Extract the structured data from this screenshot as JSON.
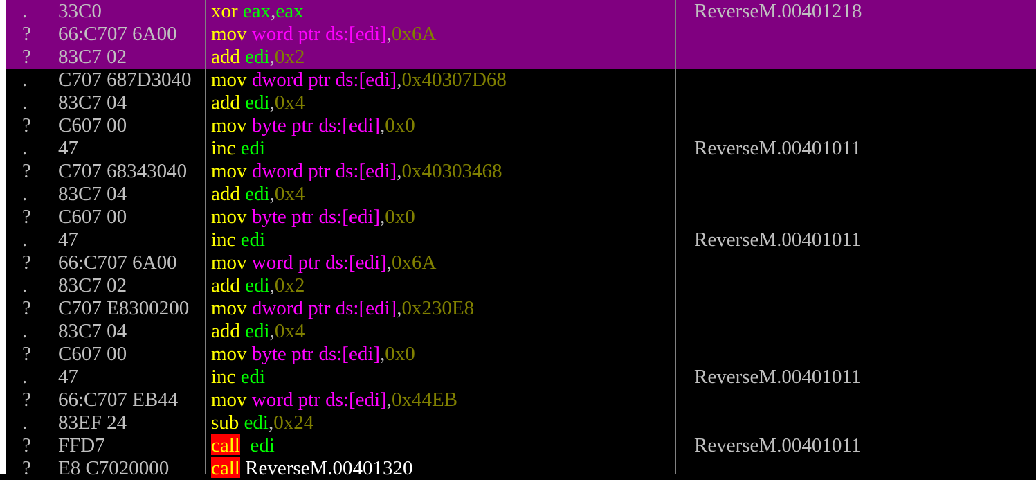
{
  "colors": {
    "selection": "#800080",
    "mnemonic": "#ffff00",
    "register": "#00ff00",
    "memory_operand": "#ff00ff",
    "immediate": "#808000",
    "call_highlight": "#ff0000",
    "text": "#c0c0c0",
    "background": "#000000"
  },
  "rows": [
    {
      "mark": ".",
      "bytes": "33C0",
      "selected": true,
      "instr": [
        {
          "t": "op",
          "v": "xor"
        },
        {
          "t": "sp",
          "v": " "
        },
        {
          "t": "reg",
          "v": "eax"
        },
        {
          "t": "punc",
          "v": ","
        },
        {
          "t": "reg",
          "v": "eax"
        }
      ],
      "comment": "ReverseM.00401218"
    },
    {
      "mark": "?",
      "bytes": "66:C707 6A00",
      "selected": true,
      "instr": [
        {
          "t": "op",
          "v": "mov"
        },
        {
          "t": "sp",
          "v": " "
        },
        {
          "t": "mem",
          "v": "word ptr ds:[edi]"
        },
        {
          "t": "punc",
          "v": ","
        },
        {
          "t": "imm",
          "v": "0x6A"
        }
      ],
      "comment": ""
    },
    {
      "mark": "?",
      "bytes": "83C7 02",
      "selected": true,
      "instr": [
        {
          "t": "op",
          "v": "add"
        },
        {
          "t": "sp",
          "v": " "
        },
        {
          "t": "reg",
          "v": "edi"
        },
        {
          "t": "punc",
          "v": ","
        },
        {
          "t": "imm",
          "v": "0x2"
        }
      ],
      "comment": ""
    },
    {
      "mark": ".",
      "bytes": "C707 687D3040",
      "selected": false,
      "instr": [
        {
          "t": "op",
          "v": "mov"
        },
        {
          "t": "sp",
          "v": " "
        },
        {
          "t": "mem",
          "v": "dword ptr ds:[edi]"
        },
        {
          "t": "punc",
          "v": ","
        },
        {
          "t": "imm",
          "v": "0x40307D68"
        }
      ],
      "comment": ""
    },
    {
      "mark": ".",
      "bytes": "83C7 04",
      "selected": false,
      "instr": [
        {
          "t": "op",
          "v": "add"
        },
        {
          "t": "sp",
          "v": " "
        },
        {
          "t": "reg",
          "v": "edi"
        },
        {
          "t": "punc",
          "v": ","
        },
        {
          "t": "imm",
          "v": "0x4"
        }
      ],
      "comment": ""
    },
    {
      "mark": "?",
      "bytes": "C607 00",
      "selected": false,
      "instr": [
        {
          "t": "op",
          "v": "mov"
        },
        {
          "t": "sp",
          "v": " "
        },
        {
          "t": "mem",
          "v": "byte ptr ds:[edi]"
        },
        {
          "t": "punc",
          "v": ","
        },
        {
          "t": "imm",
          "v": "0x0"
        }
      ],
      "comment": ""
    },
    {
      "mark": ".",
      "bytes": "47",
      "selected": false,
      "instr": [
        {
          "t": "op",
          "v": "inc"
        },
        {
          "t": "sp",
          "v": " "
        },
        {
          "t": "reg",
          "v": "edi"
        }
      ],
      "comment": "ReverseM.00401011"
    },
    {
      "mark": "?",
      "bytes": "C707 68343040",
      "selected": false,
      "instr": [
        {
          "t": "op",
          "v": "mov"
        },
        {
          "t": "sp",
          "v": " "
        },
        {
          "t": "mem",
          "v": "dword ptr ds:[edi]"
        },
        {
          "t": "punc",
          "v": ","
        },
        {
          "t": "imm",
          "v": "0x40303468"
        }
      ],
      "comment": ""
    },
    {
      "mark": ".",
      "bytes": "83C7 04",
      "selected": false,
      "instr": [
        {
          "t": "op",
          "v": "add"
        },
        {
          "t": "sp",
          "v": " "
        },
        {
          "t": "reg",
          "v": "edi"
        },
        {
          "t": "punc",
          "v": ","
        },
        {
          "t": "imm",
          "v": "0x4"
        }
      ],
      "comment": ""
    },
    {
      "mark": "?",
      "bytes": "C607 00",
      "selected": false,
      "instr": [
        {
          "t": "op",
          "v": "mov"
        },
        {
          "t": "sp",
          "v": " "
        },
        {
          "t": "mem",
          "v": "byte ptr ds:[edi]"
        },
        {
          "t": "punc",
          "v": ","
        },
        {
          "t": "imm",
          "v": "0x0"
        }
      ],
      "comment": ""
    },
    {
      "mark": ".",
      "bytes": "47",
      "selected": false,
      "instr": [
        {
          "t": "op",
          "v": "inc"
        },
        {
          "t": "sp",
          "v": " "
        },
        {
          "t": "reg",
          "v": "edi"
        }
      ],
      "comment": "ReverseM.00401011"
    },
    {
      "mark": "?",
      "bytes": "66:C707 6A00",
      "selected": false,
      "instr": [
        {
          "t": "op",
          "v": "mov"
        },
        {
          "t": "sp",
          "v": " "
        },
        {
          "t": "mem",
          "v": "word ptr ds:[edi]"
        },
        {
          "t": "punc",
          "v": ","
        },
        {
          "t": "imm",
          "v": "0x6A"
        }
      ],
      "comment": ""
    },
    {
      "mark": ".",
      "bytes": "83C7 02",
      "selected": false,
      "instr": [
        {
          "t": "op",
          "v": "add"
        },
        {
          "t": "sp",
          "v": " "
        },
        {
          "t": "reg",
          "v": "edi"
        },
        {
          "t": "punc",
          "v": ","
        },
        {
          "t": "imm",
          "v": "0x2"
        }
      ],
      "comment": ""
    },
    {
      "mark": "?",
      "bytes": "C707 E8300200",
      "selected": false,
      "instr": [
        {
          "t": "op",
          "v": "mov"
        },
        {
          "t": "sp",
          "v": " "
        },
        {
          "t": "mem",
          "v": "dword ptr ds:[edi]"
        },
        {
          "t": "punc",
          "v": ","
        },
        {
          "t": "imm",
          "v": "0x230E8"
        }
      ],
      "comment": ""
    },
    {
      "mark": ".",
      "bytes": "83C7 04",
      "selected": false,
      "instr": [
        {
          "t": "op",
          "v": "add"
        },
        {
          "t": "sp",
          "v": " "
        },
        {
          "t": "reg",
          "v": "edi"
        },
        {
          "t": "punc",
          "v": ","
        },
        {
          "t": "imm",
          "v": "0x4"
        }
      ],
      "comment": ""
    },
    {
      "mark": "?",
      "bytes": "C607 00",
      "selected": false,
      "instr": [
        {
          "t": "op",
          "v": "mov"
        },
        {
          "t": "sp",
          "v": " "
        },
        {
          "t": "mem",
          "v": "byte ptr ds:[edi]"
        },
        {
          "t": "punc",
          "v": ","
        },
        {
          "t": "imm",
          "v": "0x0"
        }
      ],
      "comment": ""
    },
    {
      "mark": ".",
      "bytes": "47",
      "selected": false,
      "instr": [
        {
          "t": "op",
          "v": "inc"
        },
        {
          "t": "sp",
          "v": " "
        },
        {
          "t": "reg",
          "v": "edi"
        }
      ],
      "comment": "ReverseM.00401011"
    },
    {
      "mark": "?",
      "bytes": "66:C707 EB44",
      "selected": false,
      "instr": [
        {
          "t": "op",
          "v": "mov"
        },
        {
          "t": "sp",
          "v": " "
        },
        {
          "t": "mem",
          "v": "word ptr ds:[edi]"
        },
        {
          "t": "punc",
          "v": ","
        },
        {
          "t": "imm",
          "v": "0x44EB"
        }
      ],
      "comment": ""
    },
    {
      "mark": ".",
      "bytes": "83EF 24",
      "selected": false,
      "instr": [
        {
          "t": "op",
          "v": "sub"
        },
        {
          "t": "sp",
          "v": " "
        },
        {
          "t": "reg",
          "v": "edi"
        },
        {
          "t": "punc",
          "v": ","
        },
        {
          "t": "imm",
          "v": "0x24"
        }
      ],
      "comment": ""
    },
    {
      "mark": "?",
      "bytes": "FFD7",
      "selected": false,
      "instr": [
        {
          "t": "call",
          "v": "call"
        },
        {
          "t": "sp",
          "v": "  "
        },
        {
          "t": "reg",
          "v": "edi"
        }
      ],
      "comment": "ReverseM.00401011"
    },
    {
      "mark": "?",
      "bytes": "E8 C7020000",
      "selected": false,
      "instr": [
        {
          "t": "call",
          "v": "call"
        },
        {
          "t": "sp",
          "v": " "
        },
        {
          "t": "target",
          "v": "ReverseM.00401320"
        }
      ],
      "comment": ""
    }
  ]
}
